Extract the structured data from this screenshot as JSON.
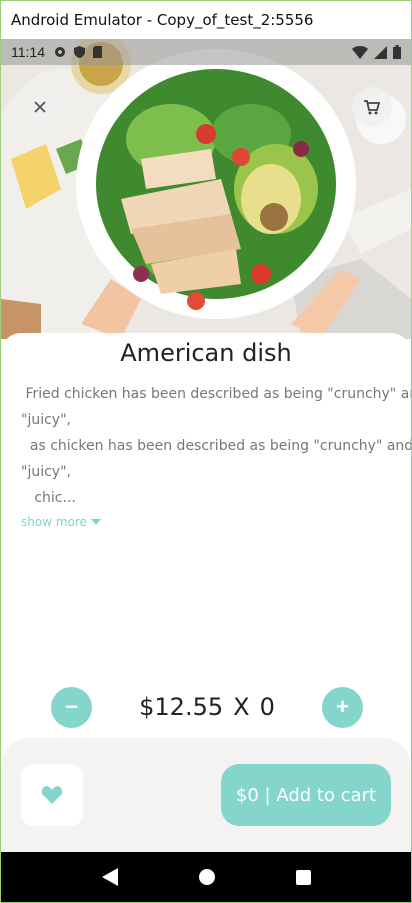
{
  "window": {
    "title": "Android Emulator - Copy_of_test_2:5556"
  },
  "status_bar": {
    "time": "11:14"
  },
  "product": {
    "name": "American dish",
    "description_lines": [
      " Fried chicken has been described as being \"crunchy\" and",
      "\"juicy\",",
      "  as chicken has been described as being \"crunchy\" and",
      "\"juicy\",",
      "   chic..."
    ],
    "show_more_label": "show more"
  },
  "quantity": {
    "price": "$12.55",
    "times": "X",
    "count": "0",
    "minus": "−",
    "plus": "+"
  },
  "cta": {
    "add_to_cart_label": "$0 | Add to cart"
  },
  "colors": {
    "accent": "#84d6cc",
    "sheet_bg": "#f5f3f2"
  },
  "icons": [
    "close-icon",
    "cart-icon",
    "heart-icon",
    "back-icon",
    "home-icon",
    "recents-icon",
    "settings-icon",
    "shield-icon",
    "sd-card-icon",
    "wifi-icon",
    "signal-icon",
    "battery-icon"
  ]
}
